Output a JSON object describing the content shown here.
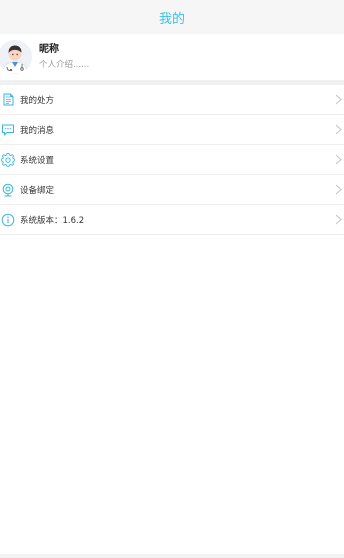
{
  "header": {
    "title": "我的"
  },
  "profile": {
    "nickname": "昵称",
    "intro": "个人介绍......"
  },
  "menu": {
    "items": [
      {
        "label": "我的处方",
        "icon": "prescription-icon"
      },
      {
        "label": "我的消息",
        "icon": "message-icon"
      },
      {
        "label": "系统设置",
        "icon": "gear-icon"
      },
      {
        "label": "设备绑定",
        "icon": "device-icon"
      },
      {
        "label": "系统版本：1.6.2",
        "icon": "info-icon"
      }
    ]
  },
  "colors": {
    "accent": "#3cc0e6",
    "icon": "#39b5de",
    "text": "#333333",
    "muted": "#999999"
  }
}
